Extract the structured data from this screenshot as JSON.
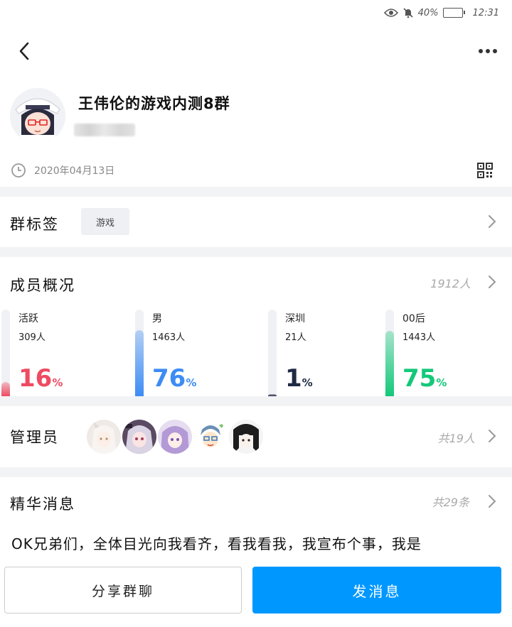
{
  "status_bar": {
    "battery": "40%",
    "time": "12:31",
    "battery_level": 0.4
  },
  "header": {
    "group_name": "王伟伦的游戏内测8群",
    "created_date": "2020年04月13日"
  },
  "tags": {
    "label": "群标签",
    "items": [
      "游戏"
    ]
  },
  "members": {
    "label": "成员概况",
    "total": "1912人",
    "stats": [
      {
        "label": "活跃",
        "count": "309人",
        "percent": "16",
        "sign": "%",
        "value": 0.16,
        "color": "#ee4b62"
      },
      {
        "label": "男",
        "count": "1463人",
        "percent": "76",
        "sign": "%",
        "value": 0.76,
        "color": "#3d8cf5"
      },
      {
        "label": "深圳",
        "count": "21人",
        "percent": "1",
        "sign": "%",
        "value": 0.01,
        "color": "#1f2a44"
      },
      {
        "label": "00后",
        "count": "1443人",
        "percent": "75",
        "sign": "%",
        "value": 0.75,
        "color": "#14c87a"
      }
    ]
  },
  "admins": {
    "label": "管理员",
    "total": "共19人"
  },
  "essence": {
    "label": "精华消息",
    "total": "共29条",
    "preview": "OK兄弟们，全体目光向我看齐，看我看我，我宣布个事，我是"
  },
  "actions": {
    "share": "分享群聊",
    "send": "发消息"
  },
  "icons": {
    "back": "chevron-left-icon",
    "more": "more-dots-icon",
    "clock": "clock-icon",
    "qr": "qr-code-icon",
    "chevron": "chevron-right-icon"
  }
}
